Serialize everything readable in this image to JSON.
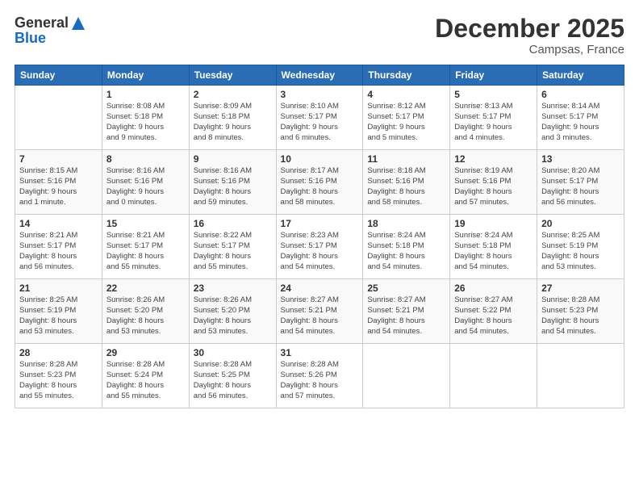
{
  "header": {
    "logo_general": "General",
    "logo_blue": "Blue",
    "month_title": "December 2025",
    "location": "Campsas, France"
  },
  "weekdays": [
    "Sunday",
    "Monday",
    "Tuesday",
    "Wednesday",
    "Thursday",
    "Friday",
    "Saturday"
  ],
  "weeks": [
    [
      {
        "day": "",
        "info": ""
      },
      {
        "day": "1",
        "info": "Sunrise: 8:08 AM\nSunset: 5:18 PM\nDaylight: 9 hours\nand 9 minutes."
      },
      {
        "day": "2",
        "info": "Sunrise: 8:09 AM\nSunset: 5:18 PM\nDaylight: 9 hours\nand 8 minutes."
      },
      {
        "day": "3",
        "info": "Sunrise: 8:10 AM\nSunset: 5:17 PM\nDaylight: 9 hours\nand 6 minutes."
      },
      {
        "day": "4",
        "info": "Sunrise: 8:12 AM\nSunset: 5:17 PM\nDaylight: 9 hours\nand 5 minutes."
      },
      {
        "day": "5",
        "info": "Sunrise: 8:13 AM\nSunset: 5:17 PM\nDaylight: 9 hours\nand 4 minutes."
      },
      {
        "day": "6",
        "info": "Sunrise: 8:14 AM\nSunset: 5:17 PM\nDaylight: 9 hours\nand 3 minutes."
      }
    ],
    [
      {
        "day": "7",
        "info": "Sunrise: 8:15 AM\nSunset: 5:16 PM\nDaylight: 9 hours\nand 1 minute."
      },
      {
        "day": "8",
        "info": "Sunrise: 8:16 AM\nSunset: 5:16 PM\nDaylight: 9 hours\nand 0 minutes."
      },
      {
        "day": "9",
        "info": "Sunrise: 8:16 AM\nSunset: 5:16 PM\nDaylight: 8 hours\nand 59 minutes."
      },
      {
        "day": "10",
        "info": "Sunrise: 8:17 AM\nSunset: 5:16 PM\nDaylight: 8 hours\nand 58 minutes."
      },
      {
        "day": "11",
        "info": "Sunrise: 8:18 AM\nSunset: 5:16 PM\nDaylight: 8 hours\nand 58 minutes."
      },
      {
        "day": "12",
        "info": "Sunrise: 8:19 AM\nSunset: 5:16 PM\nDaylight: 8 hours\nand 57 minutes."
      },
      {
        "day": "13",
        "info": "Sunrise: 8:20 AM\nSunset: 5:17 PM\nDaylight: 8 hours\nand 56 minutes."
      }
    ],
    [
      {
        "day": "14",
        "info": "Sunrise: 8:21 AM\nSunset: 5:17 PM\nDaylight: 8 hours\nand 56 minutes."
      },
      {
        "day": "15",
        "info": "Sunrise: 8:21 AM\nSunset: 5:17 PM\nDaylight: 8 hours\nand 55 minutes."
      },
      {
        "day": "16",
        "info": "Sunrise: 8:22 AM\nSunset: 5:17 PM\nDaylight: 8 hours\nand 55 minutes."
      },
      {
        "day": "17",
        "info": "Sunrise: 8:23 AM\nSunset: 5:17 PM\nDaylight: 8 hours\nand 54 minutes."
      },
      {
        "day": "18",
        "info": "Sunrise: 8:24 AM\nSunset: 5:18 PM\nDaylight: 8 hours\nand 54 minutes."
      },
      {
        "day": "19",
        "info": "Sunrise: 8:24 AM\nSunset: 5:18 PM\nDaylight: 8 hours\nand 54 minutes."
      },
      {
        "day": "20",
        "info": "Sunrise: 8:25 AM\nSunset: 5:19 PM\nDaylight: 8 hours\nand 53 minutes."
      }
    ],
    [
      {
        "day": "21",
        "info": "Sunrise: 8:25 AM\nSunset: 5:19 PM\nDaylight: 8 hours\nand 53 minutes."
      },
      {
        "day": "22",
        "info": "Sunrise: 8:26 AM\nSunset: 5:20 PM\nDaylight: 8 hours\nand 53 minutes."
      },
      {
        "day": "23",
        "info": "Sunrise: 8:26 AM\nSunset: 5:20 PM\nDaylight: 8 hours\nand 53 minutes."
      },
      {
        "day": "24",
        "info": "Sunrise: 8:27 AM\nSunset: 5:21 PM\nDaylight: 8 hours\nand 54 minutes."
      },
      {
        "day": "25",
        "info": "Sunrise: 8:27 AM\nSunset: 5:21 PM\nDaylight: 8 hours\nand 54 minutes."
      },
      {
        "day": "26",
        "info": "Sunrise: 8:27 AM\nSunset: 5:22 PM\nDaylight: 8 hours\nand 54 minutes."
      },
      {
        "day": "27",
        "info": "Sunrise: 8:28 AM\nSunset: 5:23 PM\nDaylight: 8 hours\nand 54 minutes."
      }
    ],
    [
      {
        "day": "28",
        "info": "Sunrise: 8:28 AM\nSunset: 5:23 PM\nDaylight: 8 hours\nand 55 minutes."
      },
      {
        "day": "29",
        "info": "Sunrise: 8:28 AM\nSunset: 5:24 PM\nDaylight: 8 hours\nand 55 minutes."
      },
      {
        "day": "30",
        "info": "Sunrise: 8:28 AM\nSunset: 5:25 PM\nDaylight: 8 hours\nand 56 minutes."
      },
      {
        "day": "31",
        "info": "Sunrise: 8:28 AM\nSunset: 5:26 PM\nDaylight: 8 hours\nand 57 minutes."
      },
      {
        "day": "",
        "info": ""
      },
      {
        "day": "",
        "info": ""
      },
      {
        "day": "",
        "info": ""
      }
    ]
  ]
}
